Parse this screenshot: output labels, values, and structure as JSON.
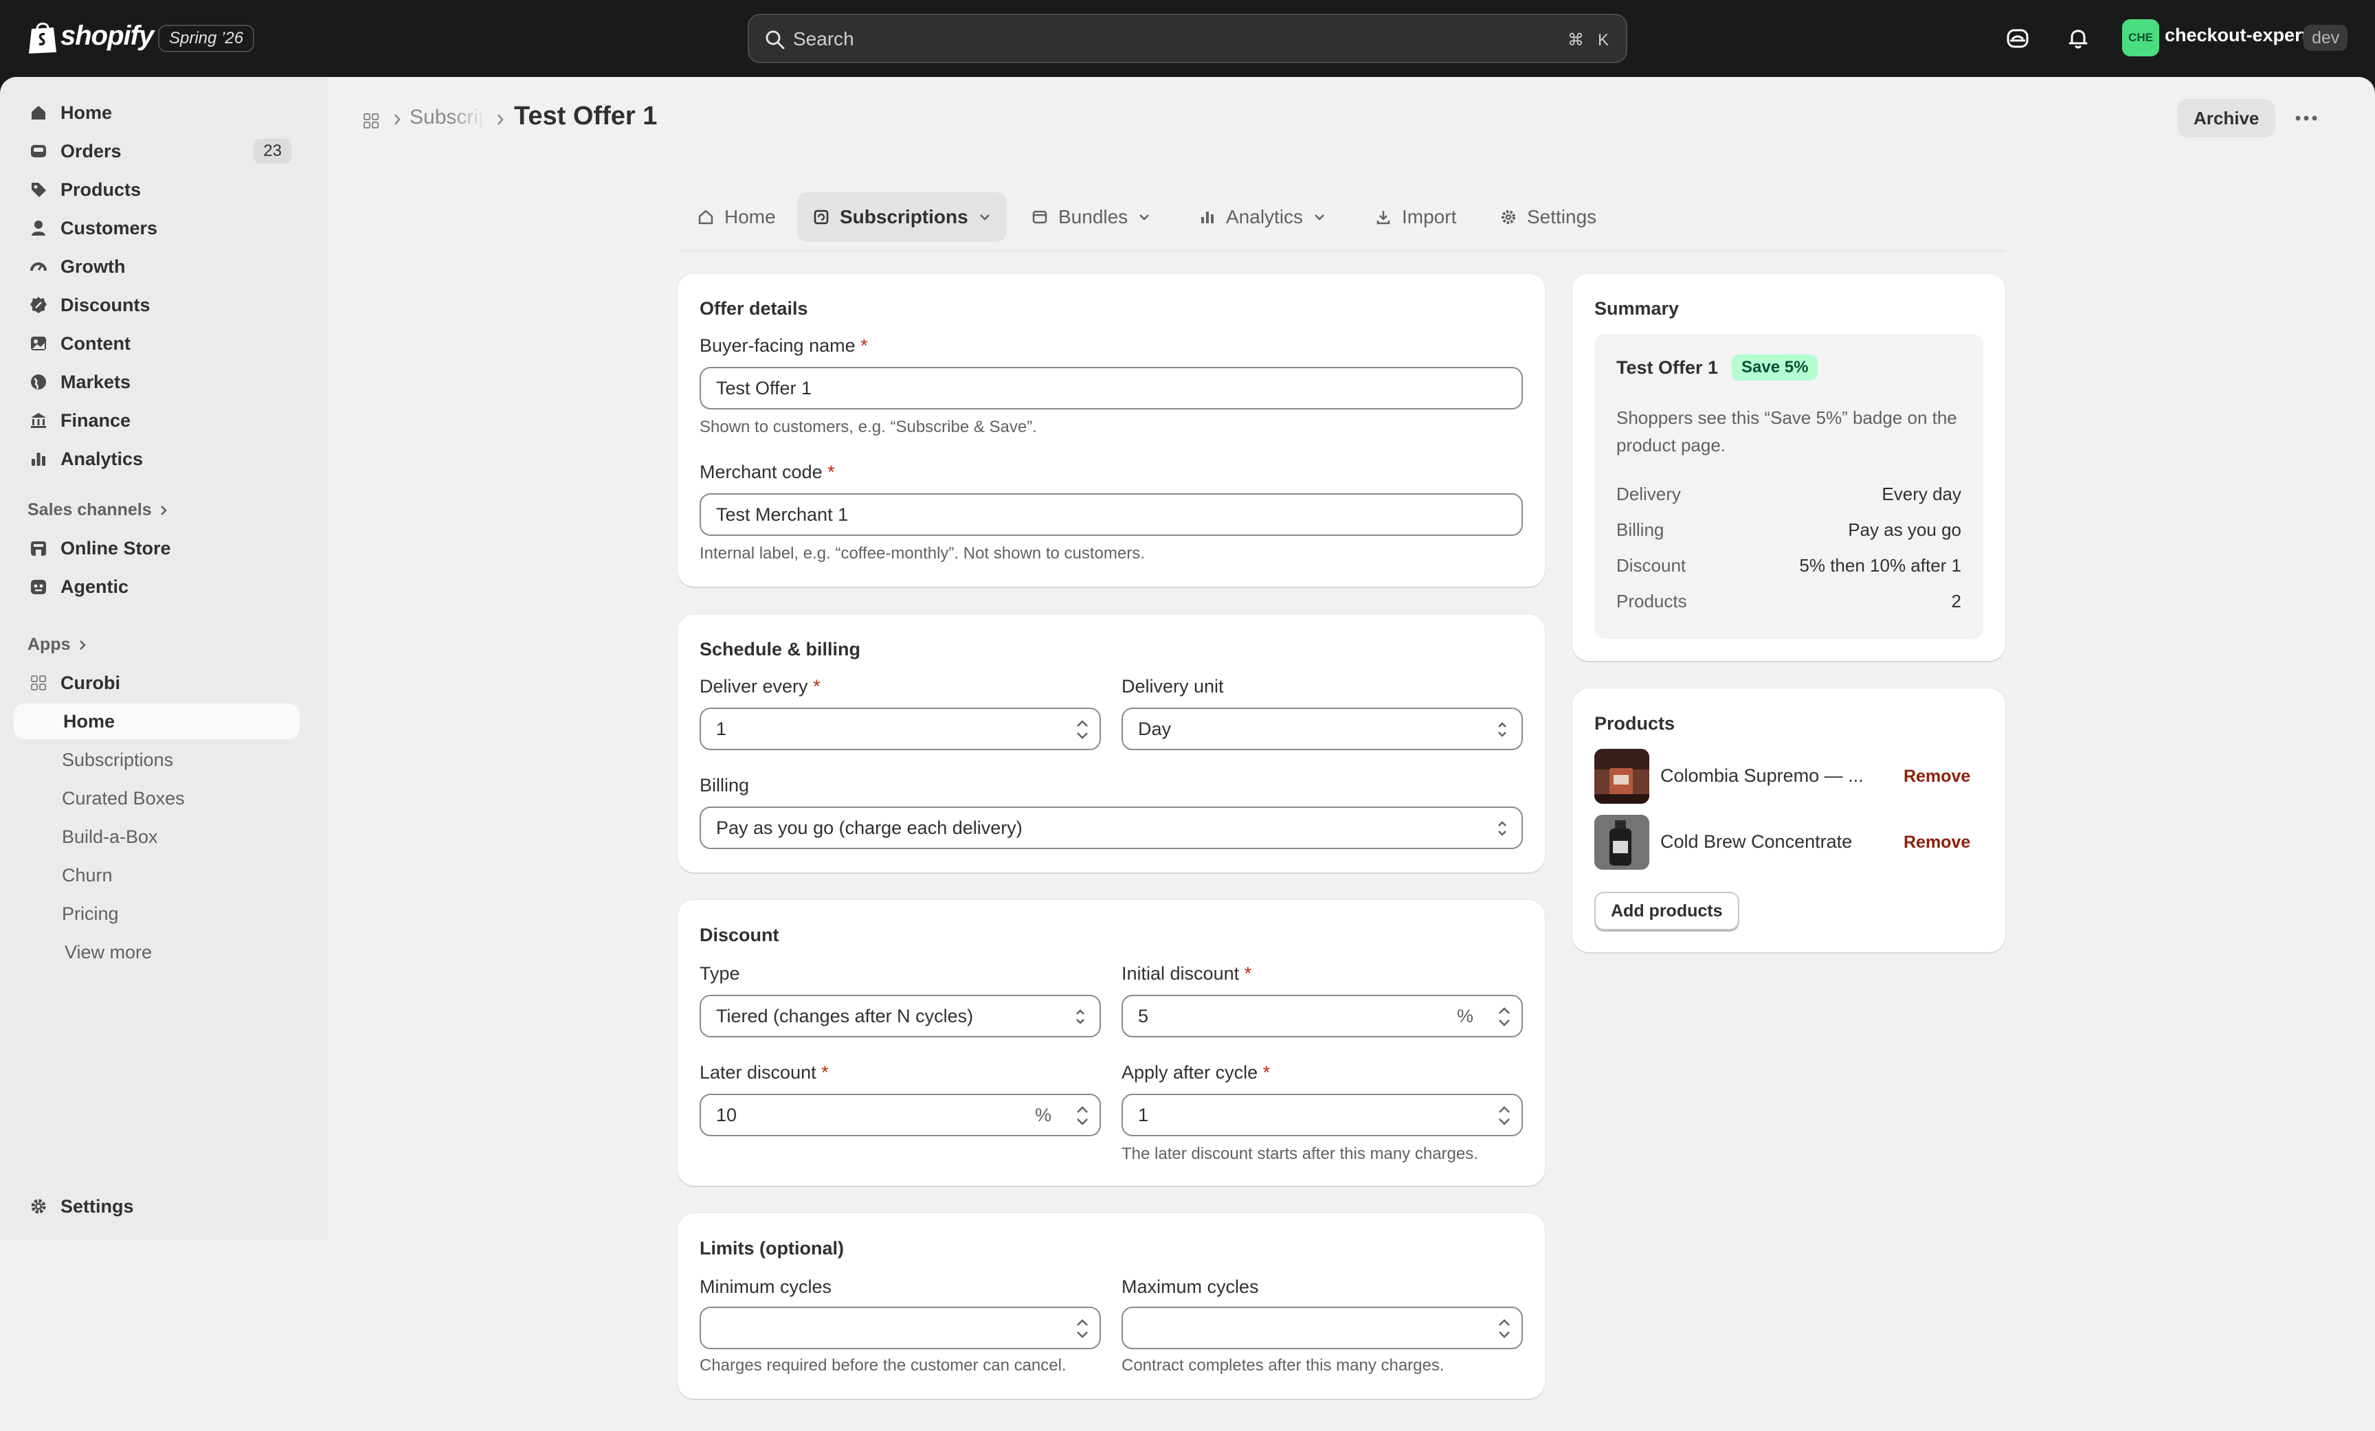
{
  "topbar": {
    "brand": "shopify",
    "release_badge": "Spring ’26",
    "search_placeholder": "Search",
    "shortcut_key1": "⌘",
    "shortcut_key2": "K",
    "store_initials": "CHE",
    "store_name": "checkout-expert",
    "store_env": "dev"
  },
  "sidebar": {
    "items": [
      {
        "label": "Home",
        "icon": "home-icon"
      },
      {
        "label": "Orders",
        "icon": "inbox-icon",
        "badge": "23"
      },
      {
        "label": "Products",
        "icon": "tag-icon"
      },
      {
        "label": "Customers",
        "icon": "person-icon"
      },
      {
        "label": "Growth",
        "icon": "gauge-icon"
      },
      {
        "label": "Discounts",
        "icon": "discount-icon"
      },
      {
        "label": "Content",
        "icon": "content-icon"
      },
      {
        "label": "Markets",
        "icon": "globe-icon"
      },
      {
        "label": "Finance",
        "icon": "bank-icon"
      },
      {
        "label": "Analytics",
        "icon": "chart-icon"
      }
    ],
    "sales_channels_heading": "Sales channels",
    "channels": [
      {
        "label": "Online Store",
        "icon": "store-icon"
      },
      {
        "label": "Agentic",
        "icon": "agent-icon"
      }
    ],
    "apps_heading": "Apps",
    "app_name": "Curobi",
    "app_items": [
      "Home",
      "Subscriptions",
      "Curated Boxes",
      "Build-a-Box",
      "Churn",
      "Pricing"
    ],
    "view_more": "View more",
    "settings": "Settings"
  },
  "header": {
    "breadcrumb": "Subscriptions",
    "title": "Test Offer 1",
    "archive": "Archive"
  },
  "tabs": [
    {
      "label": "Home",
      "icon": "home-icon"
    },
    {
      "label": "Subscriptions",
      "icon": "subscriptions-icon",
      "active": true
    },
    {
      "label": "Bundles",
      "icon": "box-icon"
    },
    {
      "label": "Analytics",
      "icon": "chart-icon"
    },
    {
      "label": "Import",
      "icon": "download-icon"
    },
    {
      "label": "Settings",
      "icon": "gear-icon"
    }
  ],
  "offer_details": {
    "title": "Offer details",
    "buyer_name_label": "Buyer-facing name",
    "buyer_name_value": "Test Offer 1",
    "buyer_name_help": "Shown to customers, e.g. “Subscribe & Save”.",
    "merchant_code_label": "Merchant code",
    "merchant_code_value": "Test Merchant 1",
    "merchant_code_help": "Internal label, e.g. “coffee-monthly”. Not shown to customers."
  },
  "schedule": {
    "title": "Schedule & billing",
    "deliver_every_label": "Deliver every",
    "deliver_every_value": "1",
    "delivery_unit_label": "Delivery unit",
    "delivery_unit_value": "Day",
    "billing_label": "Billing",
    "billing_value": "Pay as you go (charge each delivery)"
  },
  "discount": {
    "title": "Discount",
    "type_label": "Type",
    "type_value": "Tiered (changes after N cycles)",
    "initial_label": "Initial discount",
    "initial_value": "5",
    "later_label": "Later discount",
    "later_value": "10",
    "percent_suffix": "%",
    "apply_after_label": "Apply after cycle",
    "apply_after_value": "1",
    "apply_after_help": "The later discount starts after this many charges."
  },
  "limits": {
    "title": "Limits (optional)",
    "min_label": "Minimum cycles",
    "min_value": "",
    "min_help": "Charges required before the customer can cancel.",
    "max_label": "Maximum cycles",
    "max_value": "",
    "max_help": "Contract completes after this many charges."
  },
  "summary": {
    "title": "Summary",
    "offer_name": "Test Offer 1",
    "badge": "Save 5%",
    "description": "Shoppers see this “Save 5%” badge on the product page.",
    "rows": [
      {
        "label": "Delivery",
        "value": "Every day"
      },
      {
        "label": "Billing",
        "value": "Pay as you go"
      },
      {
        "label": "Discount",
        "value": "5% then 10% after 1"
      },
      {
        "label": "Products",
        "value": "2"
      }
    ]
  },
  "products": {
    "title": "Products",
    "items": [
      {
        "name": "Colombia Supremo — ...",
        "action": "Remove"
      },
      {
        "name": "Cold Brew Concentrate",
        "action": "Remove"
      }
    ],
    "add_button": "Add products"
  },
  "colors": {
    "topbar_bg": "#1a1a1a",
    "sidebar_bg": "#ebebeb",
    "main_bg": "#f1f1f1",
    "required": "#c5280c",
    "remove_link": "#8e1f0b",
    "save_badge_bg": "#b4fed2",
    "store_avatar": "#4ade80"
  }
}
